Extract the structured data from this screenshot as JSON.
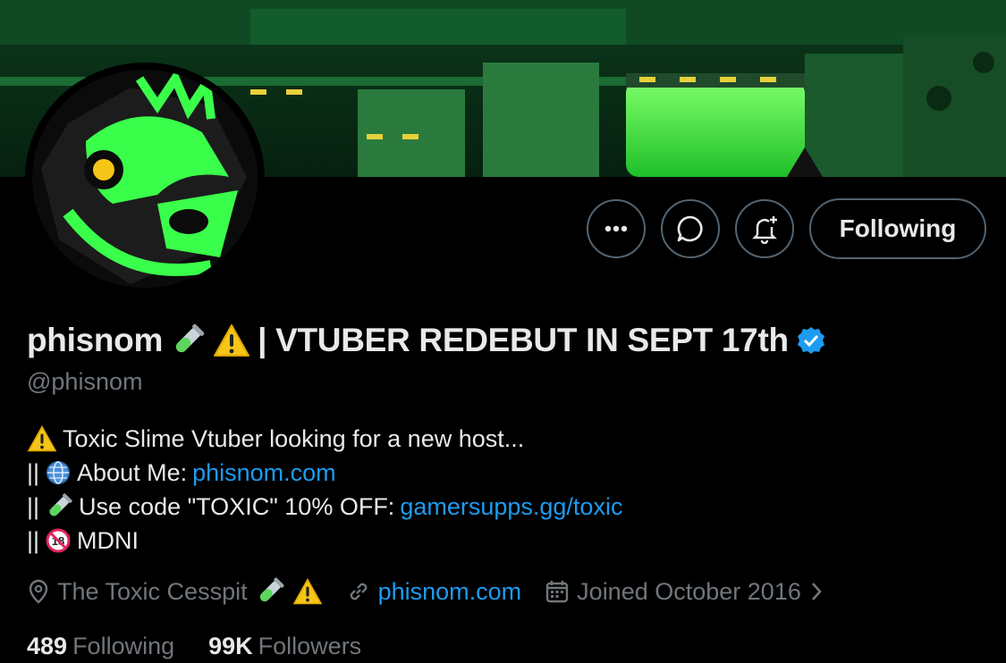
{
  "profile": {
    "name": "phisnom",
    "name_suffix": "| VTUBER REDEBUT IN SEPT 17th",
    "handle": "@phisnom",
    "follow_label": "Following"
  },
  "bio": {
    "line1": "Toxic Slime Vtuber looking for a new host...",
    "line2_prefix": "||",
    "line2_label": "About Me:",
    "line2_link": "phisnom.com",
    "line3_prefix": "||",
    "line3_label": "Use code \"TOXIC\" 10% OFF:",
    "line3_link": "gamersupps.gg/toxic",
    "line4_prefix": "||",
    "line4_label": "MDNI"
  },
  "meta": {
    "location": "The Toxic Cesspit",
    "website": "phisnom.com",
    "joined": "Joined October 2016"
  },
  "stats": {
    "following_count": "489",
    "following_label": "Following",
    "followers_count": "99K",
    "followers_label": "Followers"
  },
  "colors": {
    "accent": "#1d9bf0",
    "muted": "#71767b",
    "slime": "#39ff4a",
    "warning": "#f5c518"
  },
  "icons": [
    "more-icon",
    "message-icon",
    "notification-bell-icon",
    "verified-badge-icon",
    "test-tube-icon",
    "warning-icon",
    "globe-icon",
    "no-under-18-icon",
    "location-icon",
    "link-icon",
    "calendar-icon",
    "chevron-right-icon"
  ]
}
